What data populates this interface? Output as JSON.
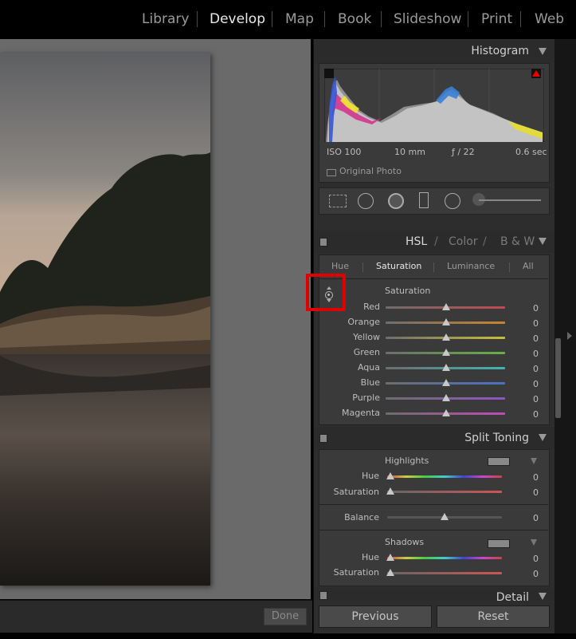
{
  "modules": [
    "Library",
    "Develop",
    "Map",
    "Book",
    "Slideshow",
    "Print",
    "Web"
  ],
  "active_module": "Develop",
  "histogram": {
    "title": "Histogram",
    "iso": "ISO 100",
    "focal": "10 mm",
    "aperture": "ƒ / 22",
    "shutter": "0.6 sec",
    "original_photo": "Original Photo"
  },
  "hsl": {
    "tabs_header": [
      "HSL",
      "Color",
      "B & W"
    ],
    "subtabs": [
      "Hue",
      "Saturation",
      "Luminance",
      "All"
    ],
    "active_subtab": "Saturation",
    "section": "Saturation",
    "sliders": [
      {
        "label": "Red",
        "value": "0",
        "color": "#c14a52"
      },
      {
        "label": "Orange",
        "value": "0",
        "color": "#c9842e"
      },
      {
        "label": "Yellow",
        "value": "0",
        "color": "#c6be3a"
      },
      {
        "label": "Green",
        "value": "0",
        "color": "#66b046"
      },
      {
        "label": "Aqua",
        "value": "0",
        "color": "#3fb4b1"
      },
      {
        "label": "Blue",
        "value": "0",
        "color": "#4a70c9"
      },
      {
        "label": "Purple",
        "value": "0",
        "color": "#8f55c4"
      },
      {
        "label": "Magenta",
        "value": "0",
        "color": "#c14ab5"
      }
    ]
  },
  "split_toning": {
    "title": "Split Toning",
    "highlights": "Highlights",
    "shadows": "Shadows",
    "hue": "Hue",
    "saturation": "Saturation",
    "balance": "Balance",
    "values": {
      "h_hue": "0",
      "h_sat": "0",
      "balance": "0",
      "s_hue": "0",
      "s_sat": "0"
    }
  },
  "detail_title": "Detail",
  "buttons": {
    "done": "Done",
    "previous": "Previous",
    "reset": "Reset"
  }
}
